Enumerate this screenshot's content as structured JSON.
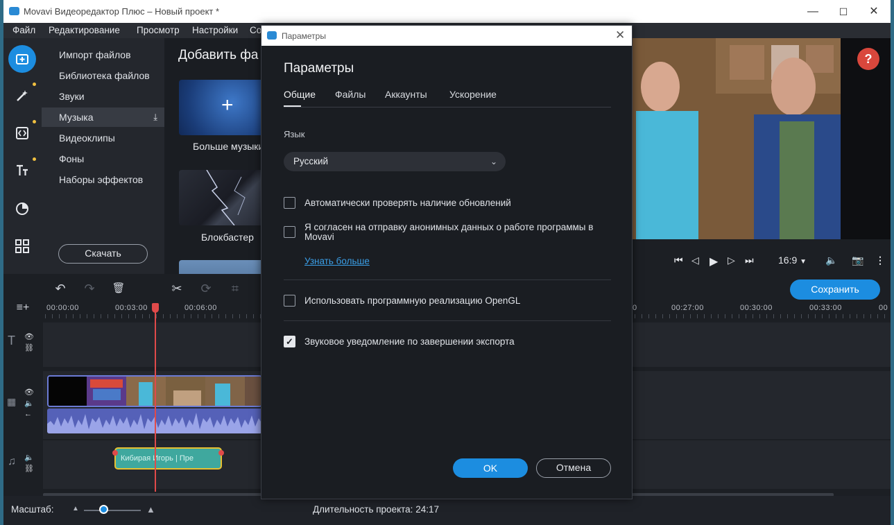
{
  "window": {
    "title": "Movavi Видеоредактор Плюс – Новый проект *",
    "minimize": "—",
    "maximize": "☐",
    "close": "✕"
  },
  "menu": [
    "Файл",
    "Редактирование",
    "Просмотр",
    "Настройки",
    "Со"
  ],
  "rail_icons": [
    "import-icon",
    "magic-wand-icon",
    "transitions-icon",
    "titles-icon",
    "filters-icon",
    "more-tools-icon"
  ],
  "categories": [
    "Импорт файлов",
    "Библиотека файлов",
    "Звуки",
    "Музыка",
    "Видеоклипы",
    "Фоны",
    "Наборы эффектов"
  ],
  "selected_category": "Музыка",
  "download_button": "Скачать",
  "content": {
    "heading": "Добавить фа",
    "tiles": [
      {
        "label": "Больше музыки"
      },
      {
        "label": "Блокбастер"
      }
    ]
  },
  "player": {
    "aspect": "16:9",
    "help": "?"
  },
  "timeline": {
    "save_button": "Сохранить",
    "ruler_ticks": [
      "00:00:00",
      "00:03:00",
      "00:06:00",
      "0",
      "00:27:00",
      "00:30:00",
      "00:33:00",
      "00"
    ],
    "music_clip_label": "Кибирая Игорь | Пре"
  },
  "status": {
    "scale_label": "Масштаб:",
    "duration_label": "Длительность проекта:",
    "duration_value": "24:17",
    "zoom_level": 0.4
  },
  "dialog": {
    "window_title": "Параметры",
    "heading": "Параметры",
    "tabs": [
      "Общие",
      "Файлы",
      "Аккаунты",
      "Ускорение"
    ],
    "active_tab": "Общие",
    "language_label": "Язык",
    "language_value": "Русский",
    "options": [
      {
        "text": "Автоматически проверять наличие обновлений",
        "checked": false
      },
      {
        "text": "Я согласен на отправку анонимных данных о работе программы в Movavi",
        "checked": false
      },
      {
        "text": "Использовать программную реализацию OpenGL",
        "checked": false
      },
      {
        "text": "Звуковое уведомление по завершении экспорта",
        "checked": true
      }
    ],
    "learn_more": "Узнать больше",
    "ok": "OK",
    "cancel": "Отмена"
  },
  "colors": {
    "accent": "#1c8de0",
    "help": "#d9473c",
    "playhead": "#e04a4a",
    "music_clip": "#3fa89e",
    "music_border": "#e8c030"
  }
}
